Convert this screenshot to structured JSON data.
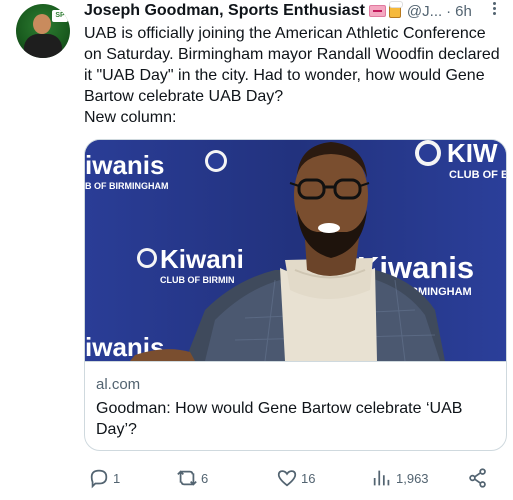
{
  "author": {
    "display_name": "Joseph Goodman, Sports Enthusiast",
    "handle": "@J...",
    "separator": "·",
    "time": "6h",
    "avatar_badge": "SP"
  },
  "tweet": {
    "lines": [
      "UAB is officially joining the American Athletic Conference on Saturday. Birmingham mayor Randall Woodfin declared it \"UAB Day\" in the city. Had to wonder, how would Gene Bartow celebrate UAB Day?",
      "New column:"
    ]
  },
  "card": {
    "image_alt": "Man in glasses and turtleneck in front of Kiwanis Club of Birmingham backdrop",
    "backdrop_texts": {
      "kiwanis_top_left": "iwanis",
      "club_top_left": "B OF BIRMINGHAM",
      "kiwanis_top_right": "KIW",
      "club_top_right": "CLUB OF E",
      "kiwanis_mid_left": "Kiwani",
      "club_mid_left": "CLUB OF BIRMIN",
      "kiwanis_mid_right": "Kiwanis",
      "club_mid_right": "BIRMINGHAM",
      "kiwanis_bottom_left": "iwanis"
    },
    "domain": "al.com",
    "title": "Goodman: How would Gene Bartow celebrate ‘UAB Day’?"
  },
  "actions": {
    "replies": "1",
    "reposts": "6",
    "likes": "16",
    "views": "1,963"
  },
  "icons": {
    "reply": "reply-icon",
    "repost": "repost-icon",
    "like": "heart-icon",
    "views": "views-icon",
    "share": "share-icon",
    "more": "more-icon"
  },
  "colors": {
    "text_primary": "#0f1419",
    "text_secondary": "#536471",
    "border": "#cfd9de",
    "backdrop_blue": "#2b3a8c"
  }
}
